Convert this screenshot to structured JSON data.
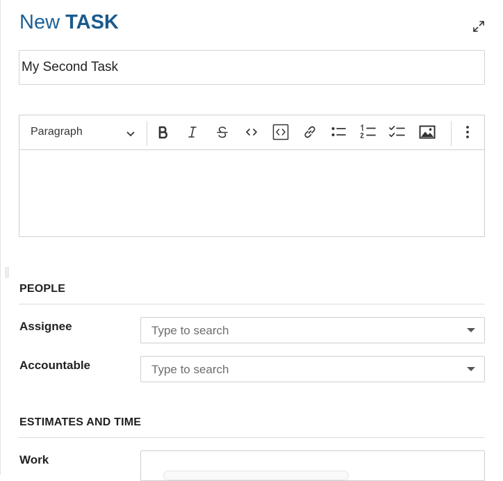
{
  "header": {
    "prefix": "New",
    "type": "TASK"
  },
  "subject": {
    "value": "My Second Task"
  },
  "editor": {
    "block_format": "Paragraph",
    "toolbar": [
      "bold-icon",
      "italic-icon",
      "strikethrough-icon",
      "inline-code-icon",
      "code-block-icon",
      "link-icon",
      "bulleted-list-icon",
      "numbered-list-icon",
      "todo-list-icon",
      "image-icon",
      "more-vertical-icon"
    ]
  },
  "people": {
    "title": "PEOPLE",
    "assignee": {
      "label": "Assignee",
      "placeholder": "Type to search"
    },
    "accountable": {
      "label": "Accountable",
      "placeholder": "Type to search"
    }
  },
  "estimates": {
    "title": "ESTIMATES AND TIME",
    "work": {
      "label": "Work"
    }
  }
}
